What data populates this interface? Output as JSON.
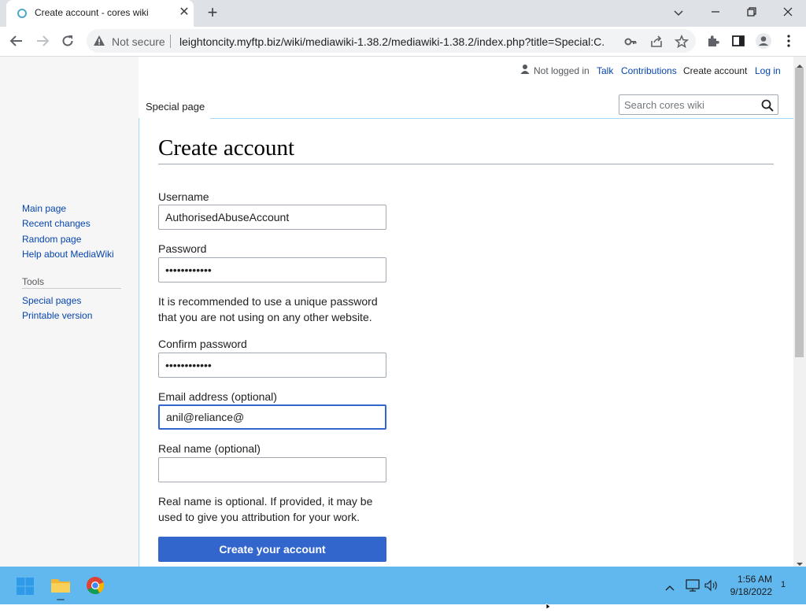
{
  "browser": {
    "tab_title": "Create account - cores wiki",
    "security_label": "Not secure",
    "url": "leightoncity.myftp.biz/wiki/mediawiki-1.38.2/mediawiki-1.38.2/index.php?title=Special:C..."
  },
  "personal_bar": {
    "status": "Not logged in",
    "links": [
      "Talk",
      "Contributions",
      "Create account",
      "Log in"
    ]
  },
  "page_tab": "Special page",
  "search": {
    "placeholder": "Search cores wiki"
  },
  "sidebar": {
    "nav": [
      "Main page",
      "Recent changes",
      "Random page",
      "Help about MediaWiki"
    ],
    "tools_heading": "Tools",
    "tools": [
      "Special pages",
      "Printable version"
    ]
  },
  "form": {
    "heading": "Create account",
    "username_label": "Username",
    "username_value": "AuthorisedAbuseAccount",
    "password_label": "Password",
    "password_value": "••••••••••••",
    "password_help": "It is recommended to use a unique password that you are not using on any other website.",
    "confirm_label": "Confirm password",
    "confirm_value": "••••••••••••",
    "email_label": "Email address (optional)",
    "email_value": "anil@reliance@",
    "realname_label": "Real name (optional)",
    "realname_value": "",
    "realname_help": "Real name is optional. If provided, it may be used to give you attribution for your work.",
    "submit_label": "Create your account"
  },
  "taskbar": {
    "time": "1:56 AM",
    "date": "9/18/2022",
    "notification_count": "1"
  },
  "colors": {
    "link": "#0645ad",
    "primary_button": "#3366cc",
    "taskbar": "#61b8ef"
  }
}
